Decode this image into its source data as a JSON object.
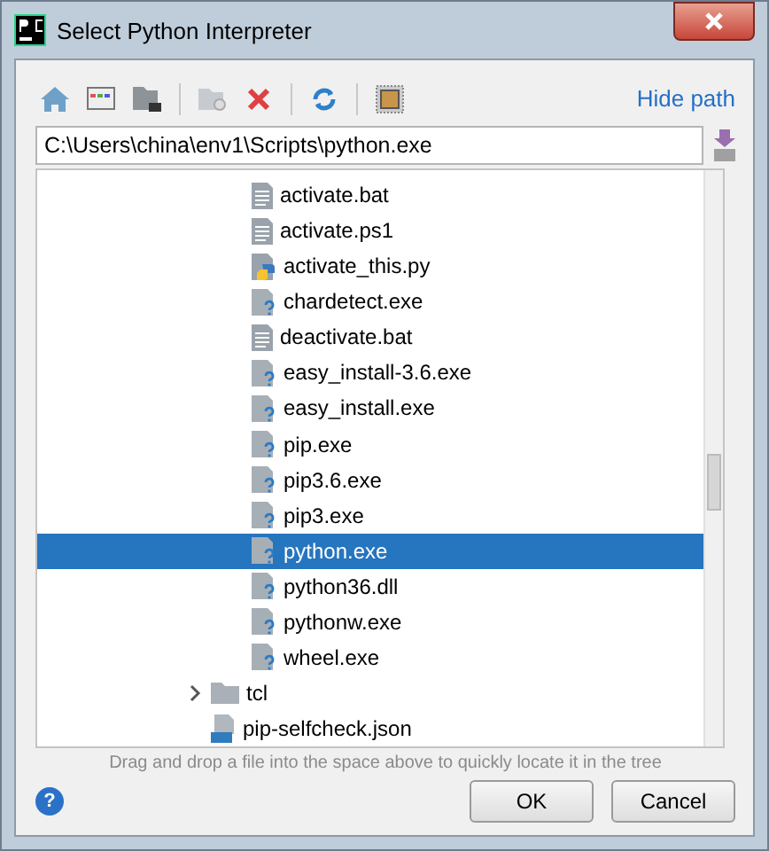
{
  "window": {
    "title": "Select Python Interpreter"
  },
  "toolbar": {
    "link": "Hide path"
  },
  "path_field": {
    "value": "C:\\Users\\china\\env1\\Scripts\\python.exe"
  },
  "tree": [
    {
      "children": [
        {
          "label": "activate.bat",
          "kind": "text",
          "selected": false
        },
        {
          "label": "activate.ps1",
          "kind": "text",
          "selected": false
        },
        {
          "label": "activate_this.py",
          "kind": "python",
          "selected": false
        },
        {
          "label": "chardetect.exe",
          "kind": "unknown",
          "selected": false
        },
        {
          "label": "deactivate.bat",
          "kind": "text",
          "selected": false
        },
        {
          "label": "easy_install-3.6.exe",
          "kind": "unknown",
          "selected": false
        },
        {
          "label": "easy_install.exe",
          "kind": "unknown",
          "selected": false
        },
        {
          "label": "pip.exe",
          "kind": "unknown",
          "selected": false
        },
        {
          "label": "pip3.6.exe",
          "kind": "unknown",
          "selected": false
        },
        {
          "label": "pip3.exe",
          "kind": "unknown",
          "selected": false
        },
        {
          "label": "python.exe",
          "kind": "unknown",
          "selected": true
        },
        {
          "label": "python36.dll",
          "kind": "unknown",
          "selected": false
        },
        {
          "label": "pythonw.exe",
          "kind": "unknown",
          "selected": false
        },
        {
          "label": "wheel.exe",
          "kind": "unknown",
          "selected": false
        }
      ]
    },
    {
      "label": "tcl",
      "kind": "folder",
      "expanded": false,
      "selected": false
    },
    {
      "label": "pip-selfcheck.json",
      "kind": "json",
      "selected": false
    }
  ],
  "hint": "Drag and drop a file into the space above to quickly locate it in the tree",
  "help_button": "?",
  "buttons": [
    "OK",
    "Cancel"
  ]
}
